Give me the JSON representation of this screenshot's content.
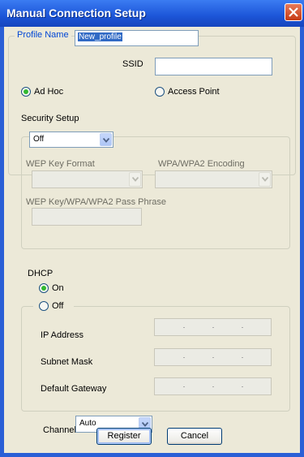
{
  "window": {
    "title": "Manual Connection Setup"
  },
  "profile": {
    "legend": "Profile Name",
    "value": "New_profile"
  },
  "ssid": {
    "label": "SSID",
    "value": ""
  },
  "mode": {
    "ad_hoc": "Ad Hoc",
    "access_point": "Access Point",
    "selected": "Ad Hoc"
  },
  "security": {
    "label": "Security Setup",
    "selected": "Off",
    "wep_key_format_label": "WEP Key Format",
    "wpa_encoding_label": "WPA/WPA2 Encoding",
    "passphrase_label": "WEP Key/WPA/WPA2 Pass Phrase"
  },
  "dhcp": {
    "label": "DHCP",
    "on": "On",
    "off": "Off",
    "selected": "On",
    "ip_address_label": "IP Address",
    "subnet_mask_label": "Subnet Mask",
    "default_gateway_label": "Default Gateway"
  },
  "channel": {
    "label": "Channel",
    "selected": "Auto"
  },
  "buttons": {
    "register": "Register",
    "cancel": "Cancel"
  },
  "colors": {
    "title_bar": "#2a5fd6",
    "dialog_bg": "#ece9d8",
    "group_label": "#0046d5",
    "radio_dot": "#31b831"
  }
}
